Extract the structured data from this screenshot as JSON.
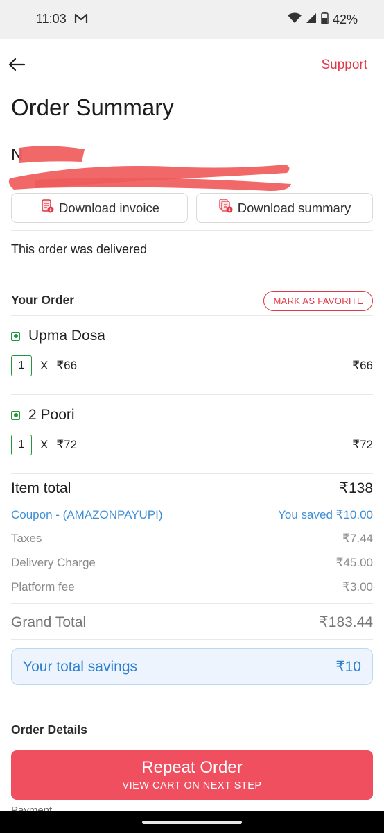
{
  "status_bar": {
    "time": "11:03",
    "battery": "42%"
  },
  "header": {
    "support_label": "Support"
  },
  "page": {
    "title": "Order Summary"
  },
  "actions": {
    "download_invoice": "Download invoice",
    "download_summary": "Download summary"
  },
  "order": {
    "status_text": "This order was delivered",
    "section_title": "Your Order",
    "favorite_label": "MARK AS FAVORITE",
    "items": [
      {
        "name": "Upma Dosa",
        "qty": "1",
        "x": "X",
        "unit_price": "₹66",
        "line_total": "₹66"
      },
      {
        "name": "2 Poori",
        "qty": "1",
        "x": "X",
        "unit_price": "₹72",
        "line_total": "₹72"
      }
    ]
  },
  "bill": {
    "item_total_label": "Item total",
    "item_total_value": "₹138",
    "coupon_label": "Coupon - (AMAZONPAYUPI)",
    "coupon_value": "You saved ₹10.00",
    "taxes_label": "Taxes",
    "taxes_value": "₹7.44",
    "delivery_label": "Delivery Charge",
    "delivery_value": "₹45.00",
    "platform_label": "Platform fee",
    "platform_value": "₹3.00",
    "grand_total_label": "Grand Total",
    "grand_total_value": "₹183.44"
  },
  "savings": {
    "label": "Your total savings",
    "value": "₹10"
  },
  "details": {
    "section_title": "Order Details",
    "payment_label": "Payment"
  },
  "cta": {
    "title": "Repeat Order",
    "subtitle": "VIEW CART ON NEXT STEP"
  },
  "colors": {
    "accent": "#e23744",
    "cta": "#ef4f5f",
    "veg": "#24963f",
    "blue": "#3f8fd6"
  },
  "icons": [
    "mail-icon",
    "wifi-icon",
    "signal-icon",
    "battery-icon",
    "back-arrow-icon",
    "invoice-icon",
    "summary-icon",
    "veg-icon"
  ]
}
